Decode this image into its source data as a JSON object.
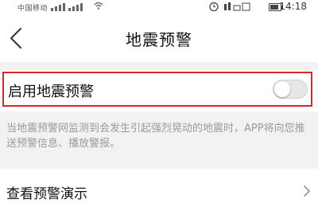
{
  "status_bar": {
    "carrier": "中国移动",
    "time": "14:18",
    "battery_level": 0.8
  },
  "header": {
    "title": "地震预警"
  },
  "settings": {
    "enable_label": "启用地震预警",
    "enable_state": false,
    "description": "当地震预警网监测到会发生引起强烈晃动的地震时，APP将向您推送预警信息、播放警报。",
    "demo_label": "查看预警演示"
  },
  "colors": {
    "highlight_border": "#d9242a",
    "toggle_off": "#e6e6e6",
    "page_background": "#f2f2f2"
  }
}
